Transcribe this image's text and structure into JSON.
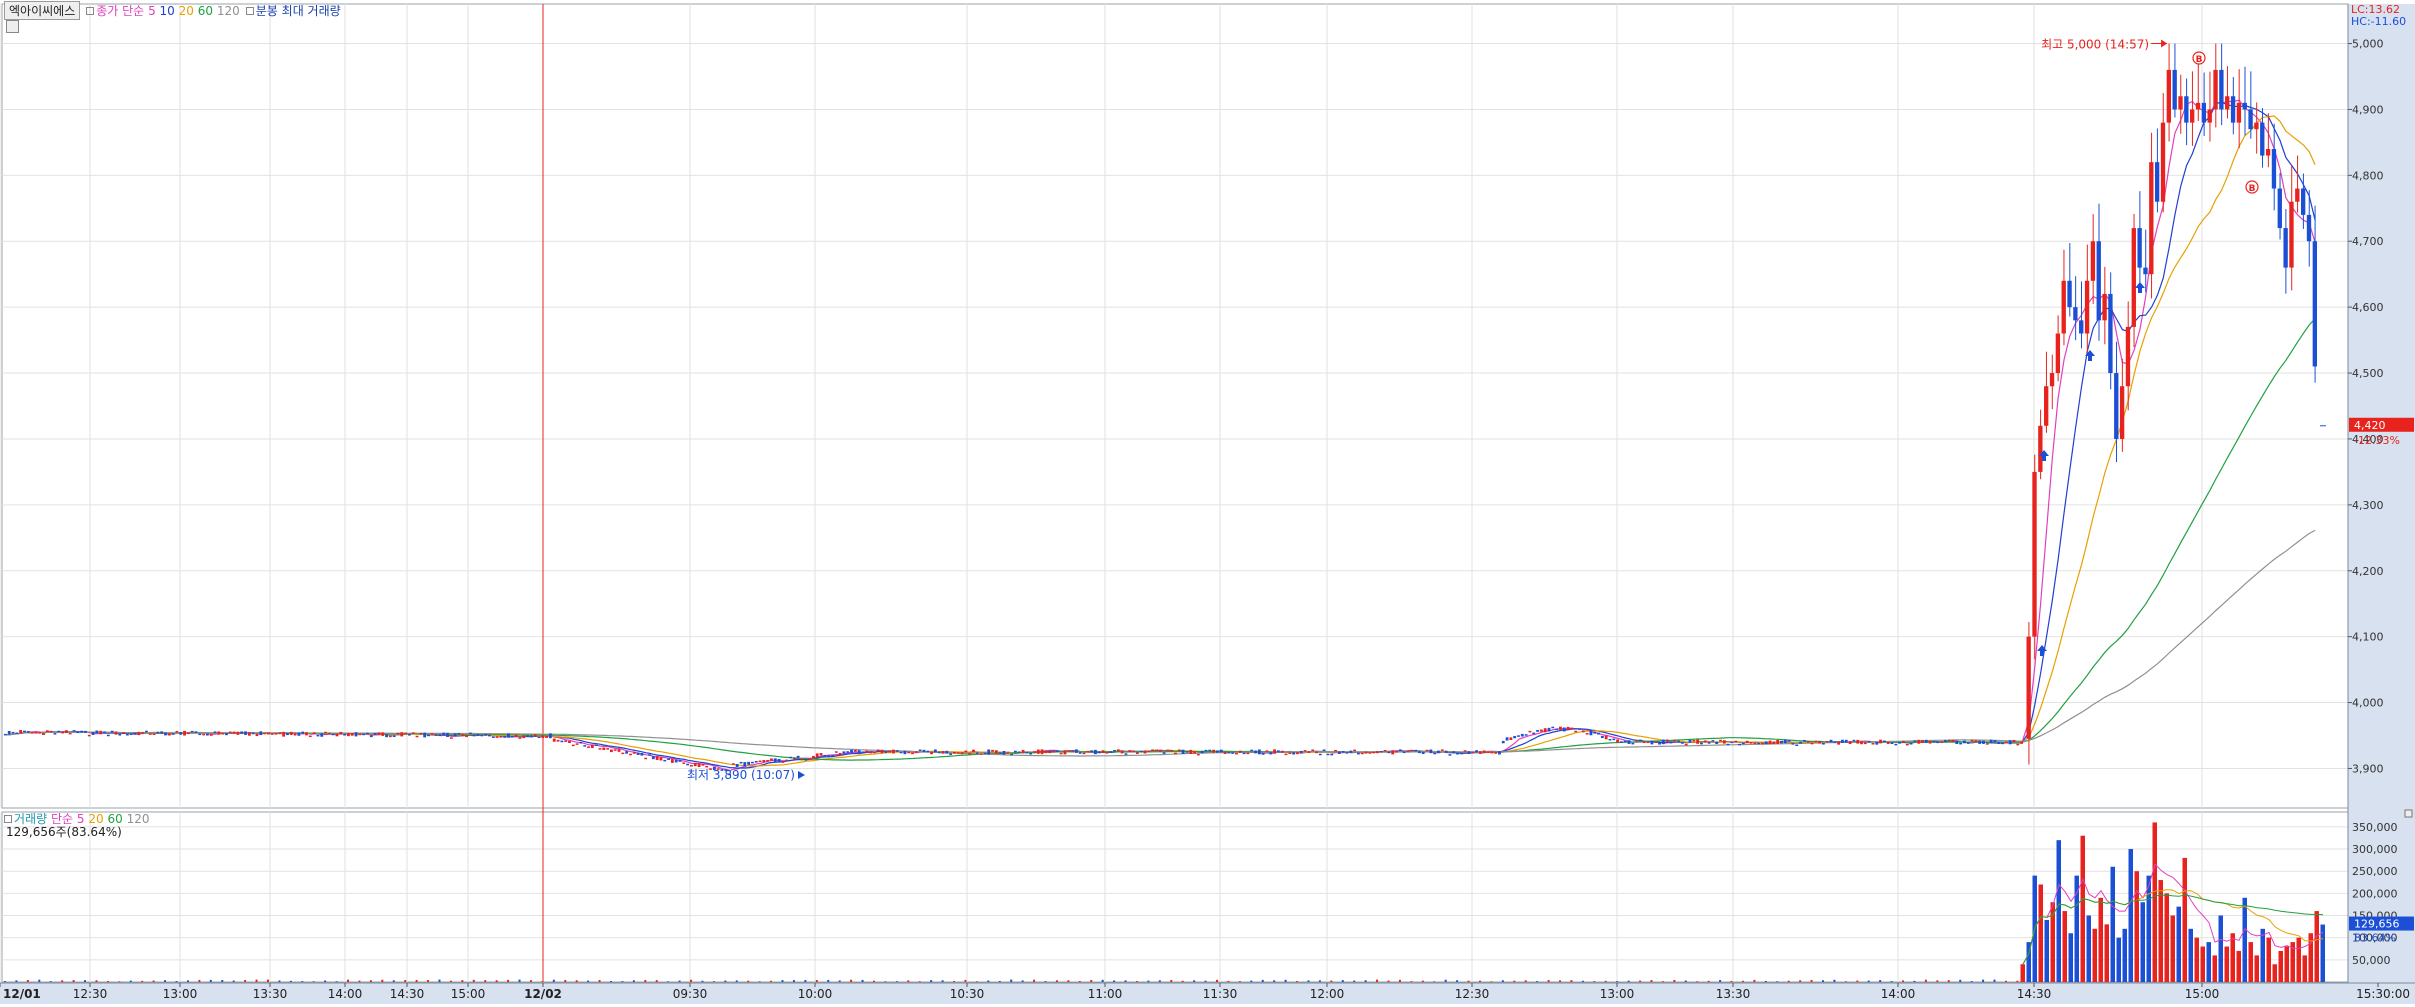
{
  "header": {
    "stock_name": "엑아이씨에스",
    "ma_label": "종가 단순",
    "ma_periods": [
      "5",
      "10",
      "20",
      "60",
      "120"
    ],
    "volume_label": "분봉 최대 거래량"
  },
  "volume_header": {
    "title": "거래량",
    "ma_label": "단순",
    "periods": [
      "5",
      "20",
      "60",
      "120"
    ],
    "current": "129,656주(83.64%)"
  },
  "right_info": {
    "lc": "LC:13.62",
    "hc": "HC:-11.60"
  },
  "current_price": {
    "value": "4,420",
    "pct": "-12.33%"
  },
  "current_volume": {
    "value": "129,656",
    "pct": "83.64%"
  },
  "annotations": {
    "high": "최고 5,000 (14:57)",
    "low": "최저 3,890 (10:07)",
    "b_marker": "B"
  },
  "colors": {
    "up": "#e8231d",
    "down": "#1a4fd6",
    "ma5": "#e040c0",
    "ma10": "#2040d0",
    "ma20": "#e8a000",
    "ma60": "#20a040",
    "ma120": "#909090",
    "grid": "#e2e2e2",
    "axis_bg": "#d7e1ef",
    "price_tag": "#e8231d",
    "volume_tag": "#1a4fd6"
  },
  "chart_data": [
    {
      "type": "candlestick",
      "title": "",
      "interval": "1-minute",
      "ylim": [
        3840,
        5060
      ],
      "y_ticks": [
        "3,900",
        "4,000",
        "4,100",
        "4,200",
        "4,300",
        "4,400",
        "4,500",
        "4,600",
        "4,700",
        "4,800",
        "4,900",
        "5,000"
      ],
      "y_tick_values": [
        3900,
        4000,
        4100,
        4200,
        4300,
        4400,
        4500,
        4600,
        4700,
        4800,
        4900,
        5000
      ],
      "x_ticks": [
        "12/01",
        "12:30",
        "13:00",
        "13:30",
        "14:00",
        "14:30",
        "15:00",
        "12/02",
        "09:30",
        "10:00",
        "10:30",
        "11:00",
        "11:30",
        "12:00",
        "12:30",
        "13:00",
        "13:30",
        "14:00",
        "14:30",
        "15:00",
        "15:30:00"
      ],
      "segments": [
        {
          "name": "early",
          "base": 3955,
          "amp": 10
        },
        {
          "name": "dip",
          "base": 3905,
          "amp": 15
        },
        {
          "name": "flat",
          "base": 3925,
          "amp": 10
        },
        {
          "name": "flat2",
          "base": 3940,
          "amp": 15
        }
      ],
      "spike_closes": [
        4100,
        4350,
        4420,
        4480,
        4500,
        4560,
        4640,
        4600,
        4580,
        4560,
        4640,
        4700,
        4580,
        4620,
        4500,
        4400,
        4480,
        4570,
        4720,
        4660,
        4650,
        4820,
        4760,
        4880,
        4960,
        4900,
        4920,
        4880,
        4900,
        4910,
        4880,
        4900,
        4960,
        4900,
        4920,
        4880,
        4910,
        4900,
        4870,
        4880,
        4830,
        4840,
        4780,
        4720,
        4660,
        4760,
        4780,
        4740,
        4700,
        4510
      ],
      "high": 5000,
      "high_time": "14:57",
      "low": 3890,
      "low_time": "10:07",
      "last": 4420
    },
    {
      "type": "bar",
      "title": "거래량",
      "ylim": [
        0,
        370000
      ],
      "y_ticks": [
        "50,000",
        "100,000",
        "150,000",
        "200,000",
        "250,000",
        "300,000",
        "350,000"
      ],
      "y_tick_values": [
        50000,
        100000,
        150000,
        200000,
        250000,
        300000,
        350000
      ],
      "spike_volumes": [
        40000,
        90000,
        240000,
        220000,
        140000,
        180000,
        320000,
        160000,
        110000,
        240000,
        330000,
        150000,
        120000,
        190000,
        130000,
        260000,
        100000,
        120000,
        300000,
        250000,
        180000,
        240000,
        360000,
        230000,
        200000,
        150000,
        170000,
        280000,
        120000,
        100000,
        80000,
        90000,
        60000,
        150000,
        80000,
        110000,
        70000,
        190000,
        90000,
        60000,
        120000,
        100000,
        40000,
        70000,
        80000,
        90000,
        100000,
        60000,
        110000,
        160000,
        129656
      ],
      "last": 129656
    }
  ]
}
